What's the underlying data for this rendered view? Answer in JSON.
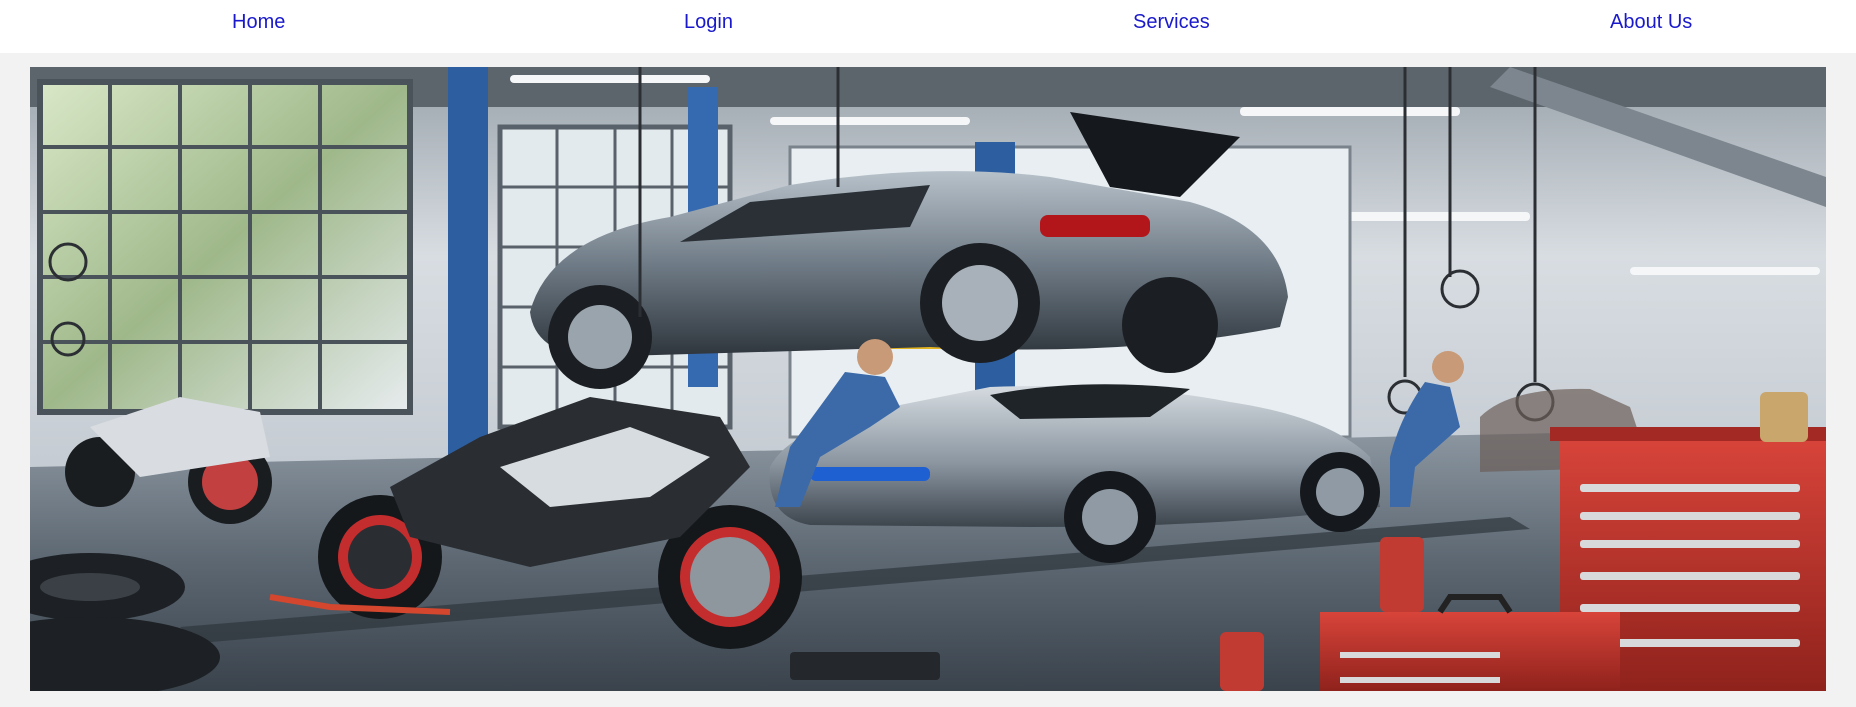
{
  "nav": {
    "items": [
      {
        "label": "Home"
      },
      {
        "label": "Login"
      },
      {
        "label": "Services"
      },
      {
        "label": "About Us"
      }
    ],
    "link_color": "#1a1acc",
    "bar_color": "#ffffff"
  },
  "page": {
    "background_color": "#f2f2f2"
  },
  "hero": {
    "image_subject": "auto repair garage with cars on lift, sports car, motorcycles, mechanics and red tool chests",
    "colors": {
      "floor": "#55606b",
      "wall": "#d6dbe0",
      "lift_blue": "#2d5fa0",
      "toolbox_red": "#c0322b",
      "car_silver": "#8e99a4"
    }
  }
}
